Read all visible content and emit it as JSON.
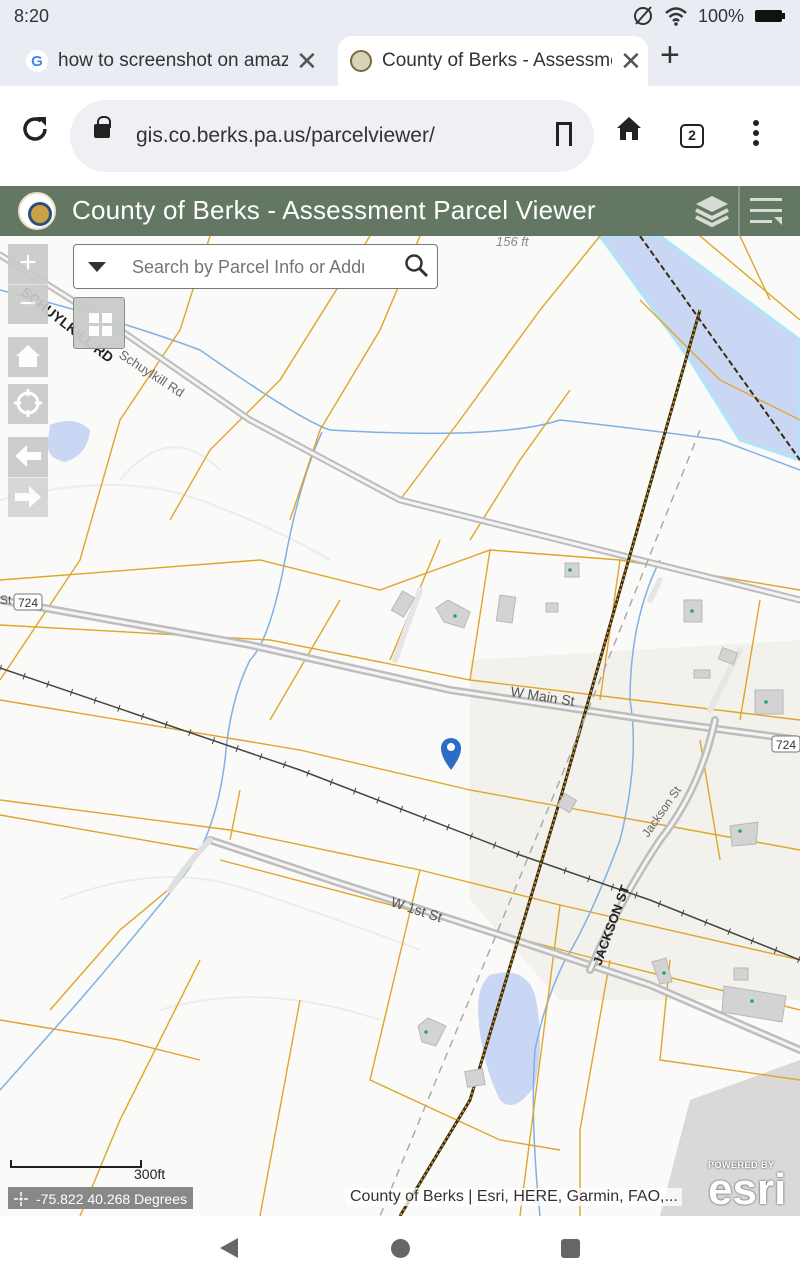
{
  "status_bar": {
    "time": "8:20",
    "battery": "100%"
  },
  "tabs": [
    {
      "title": "how to screenshot on amazon fire tablet",
      "favicon": "google-icon",
      "active": false
    },
    {
      "title": "County of Berks - Assessment Parcel Viewer",
      "favicon": "berks-seal-icon",
      "active": true
    }
  ],
  "toolbar": {
    "url": "gis.co.berks.pa.us/parcelviewer/",
    "tab_count": "2"
  },
  "app": {
    "title": "County of Berks - Assessment Parcel Viewer"
  },
  "search": {
    "placeholder": "Search by Parcel Info or Address"
  },
  "map": {
    "labels": {
      "contour": "156 ft",
      "schuylkill_rd_bold": "SCHUYLKILL RD",
      "schuylkill_rd": "Schuylkill Rd",
      "route_724_left": "724",
      "st_left": "St",
      "w_main": "W Main St",
      "route_724_right": "724",
      "w_1st": "W 1st St",
      "jackson_bold": "JACKSON ST",
      "jackson": "Jackson St"
    },
    "scale_label": "300ft",
    "coordinates": "-75.822 40.268 Degrees",
    "attribution": "County of Berks | Esri, HERE, Garmin, FAO,...",
    "esri_powered": "POWERED BY",
    "esri_word": "esri"
  },
  "colors": {
    "header": "#647762",
    "parcel_line": "#e0a52a",
    "water": "#c9d7f5",
    "stream": "#7fb0e6",
    "road": "#bdbdbd",
    "marker": "#2b6cc4"
  }
}
